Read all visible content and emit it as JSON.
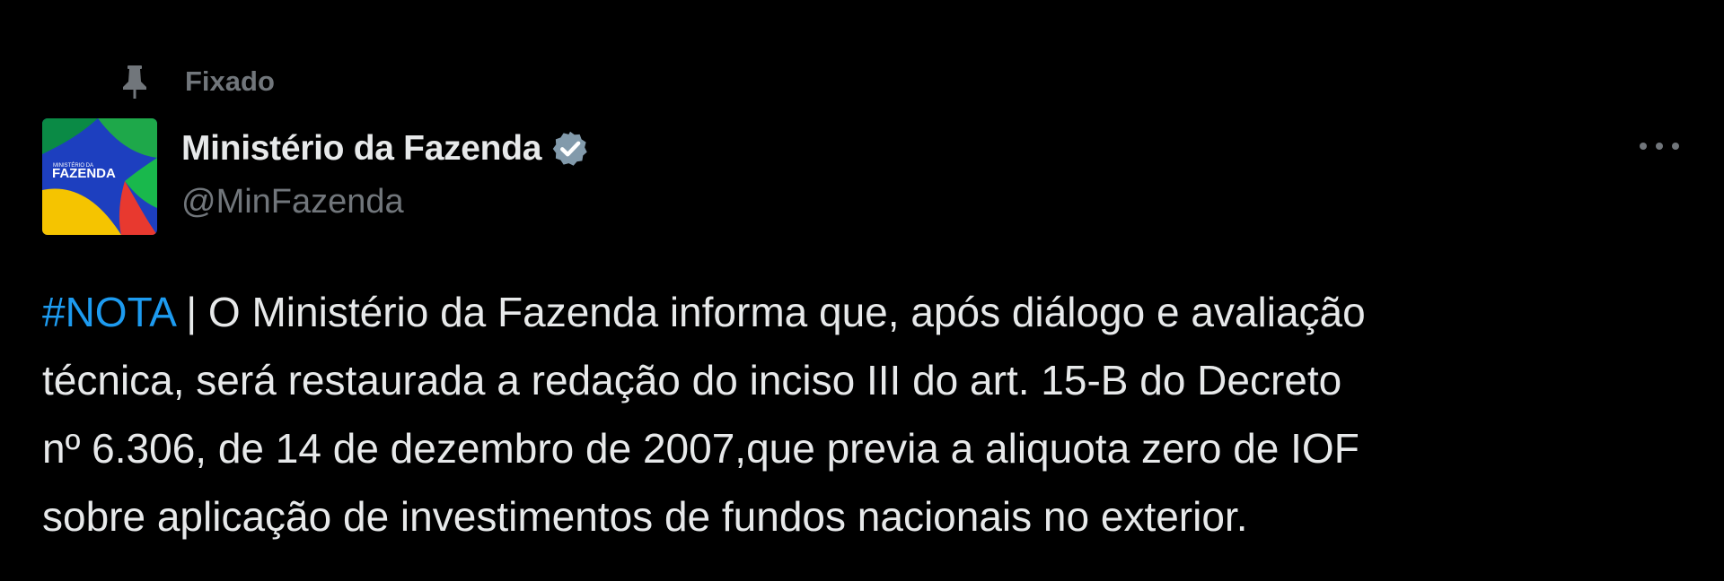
{
  "pinned": {
    "label": "Fixado",
    "icon": "pin-icon"
  },
  "author": {
    "display_name": "Ministério da Fazenda",
    "handle": "@MinFazenda",
    "verified_icon": "verified-badge-icon",
    "verified_color": "#829aab",
    "avatar": {
      "small_text": "MINISTÉRIO DA",
      "big_text": "FAZENDA"
    }
  },
  "menu": {
    "icon": "more-options-icon"
  },
  "tweet": {
    "hashtag": "#NOTA",
    "lines": [
      " | O Ministério da Fazenda informa que, após diálogo e avaliação",
      "técnica, será restaurada a redação do inciso III do art. 15-B do Decreto",
      "nº 6.306, de 14 de dezembro de 2007,que previa a aliquota zero de IOF",
      "sobre aplicação de investimentos de fundos nacionais no exterior."
    ]
  },
  "colors": {
    "background": "#000000",
    "text": "#e7e9ea",
    "secondary": "#71767b",
    "link": "#1d9bf0"
  }
}
